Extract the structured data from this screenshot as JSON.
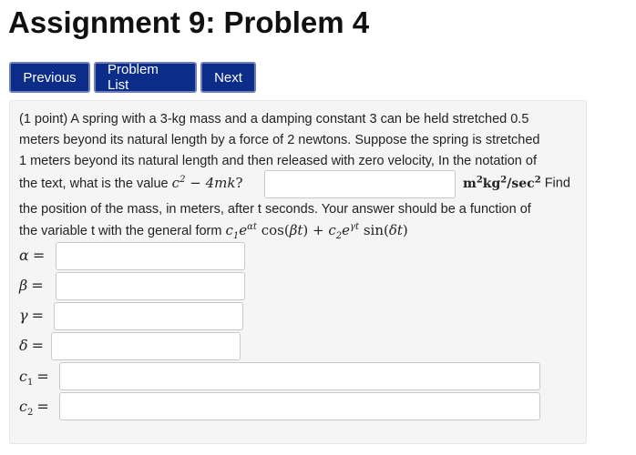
{
  "title": "Assignment 9: Problem 4",
  "nav": {
    "previous_label": "Previous",
    "problem_list_label": "Problem List",
    "next_label": "Next"
  },
  "problem": {
    "points": "(1 point)",
    "line1_rest": " A spring with a 3-kg mass and a damping constant 3 can be held stretched 0.5",
    "line2": "meters beyond its natural length by a force of 2 newtons. Suppose the spring is stretched",
    "line3": "1 meters beyond its natural length and then released with zero velocity, In the notation of",
    "line4_prefix": "the text, what is the value ",
    "line4_suffix": " Find",
    "line5": "the position of the mass, in meters, after t seconds. Your answer should be a function of",
    "line6_prefix": "the variable t with the general form ",
    "answers": {
      "discriminant": "",
      "alpha": "",
      "beta": "",
      "gamma": "",
      "delta": "",
      "c1": "",
      "c2": ""
    }
  }
}
